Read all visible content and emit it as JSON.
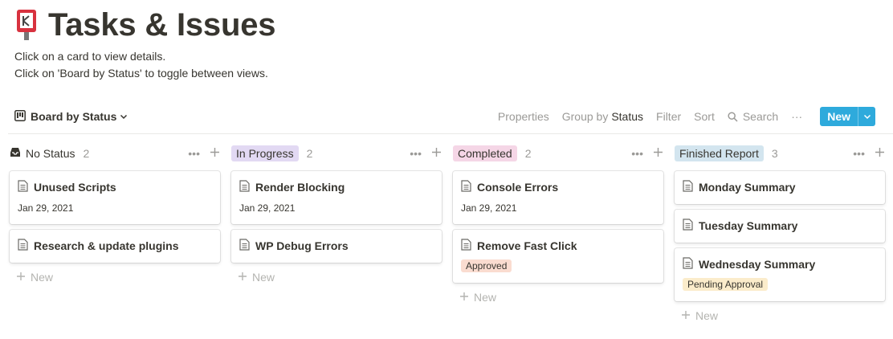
{
  "page": {
    "title": "Tasks & Issues",
    "icon": "kanban-board-icon",
    "description": [
      "Click on a card to view details.",
      "Click on 'Board by Status' to toggle between views."
    ]
  },
  "toolbar": {
    "view_label": "Board by Status",
    "properties": "Properties",
    "group_by_prefix": "Group by",
    "group_by_value": "Status",
    "filter": "Filter",
    "sort": "Sort",
    "search": "Search",
    "more": "···",
    "new_label": "New",
    "new_color": "#2eaadc"
  },
  "columns": [
    {
      "label": "No Status",
      "count": "2",
      "tag_bg": "transparent",
      "cards": [
        {
          "title": "Unused Scripts",
          "date": "Jan 29, 2021"
        },
        {
          "title": "Research & update plugins"
        }
      ],
      "new_label": "New"
    },
    {
      "label": "In Progress",
      "count": "2",
      "tag_bg": "#e2d9f3",
      "cards": [
        {
          "title": "Render Blocking",
          "date": "Jan 29, 2021"
        },
        {
          "title": "WP Debug Errors"
        }
      ],
      "new_label": "New"
    },
    {
      "label": "Completed",
      "count": "2",
      "tag_bg": "#f5d6e6",
      "cards": [
        {
          "title": "Console Errors",
          "date": "Jan 29, 2021"
        },
        {
          "title": "Remove Fast Click",
          "tag": "Approved",
          "tag_bg": "#fadcd0"
        }
      ],
      "new_label": "New"
    },
    {
      "label": "Finished Report",
      "count": "3",
      "tag_bg": "#d3e5ef",
      "cards": [
        {
          "title": "Monday Summary"
        },
        {
          "title": "Tuesday Summary"
        },
        {
          "title": "Wednesday Summary",
          "tag": "Pending Approval",
          "tag_bg": "#fbeccb"
        }
      ],
      "new_label": "New"
    }
  ]
}
